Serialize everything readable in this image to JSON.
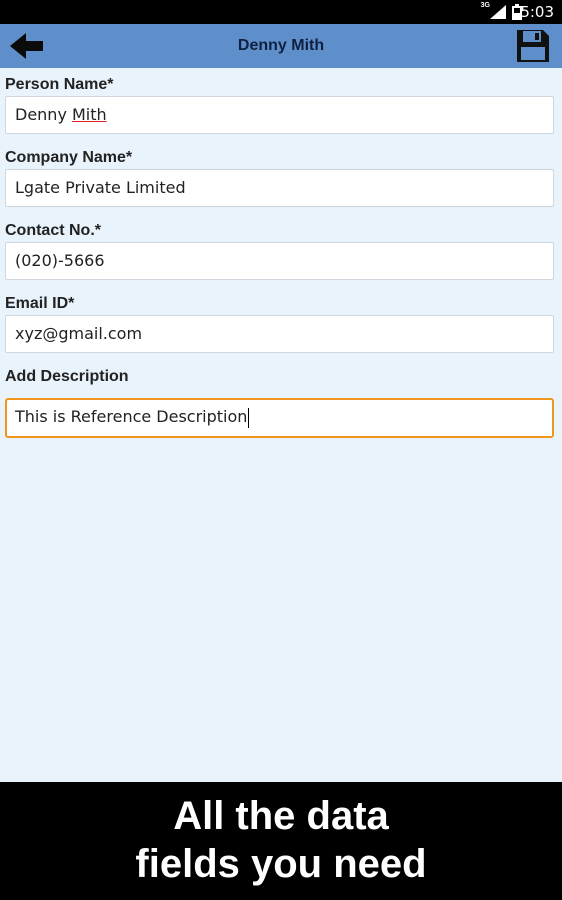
{
  "status_bar": {
    "time": "5:03",
    "network": "3G",
    "icons": [
      "signal-icon",
      "battery-icon"
    ]
  },
  "app_bar": {
    "title": "Denny Mith",
    "back_icon": "arrow-left-icon",
    "save_icon": "floppy-disk-icon",
    "color": "#5f8fcb"
  },
  "form": {
    "person_name": {
      "label": "Person Name*",
      "value_first": "Denny ",
      "value_misspelled": "Mith"
    },
    "company_name": {
      "label": "Company Name*",
      "value": "Lgate Private Limited"
    },
    "contact_no": {
      "label": "Contact No.*",
      "value": "(020)-5666"
    },
    "email": {
      "label": "Email ID*",
      "value": "xyz@gmail.com"
    },
    "description": {
      "label": "Add Description",
      "value": "This is Reference Description",
      "focus_color": "#f0961e"
    }
  },
  "banner": {
    "line1": "All the data",
    "line2": "fields you need"
  }
}
